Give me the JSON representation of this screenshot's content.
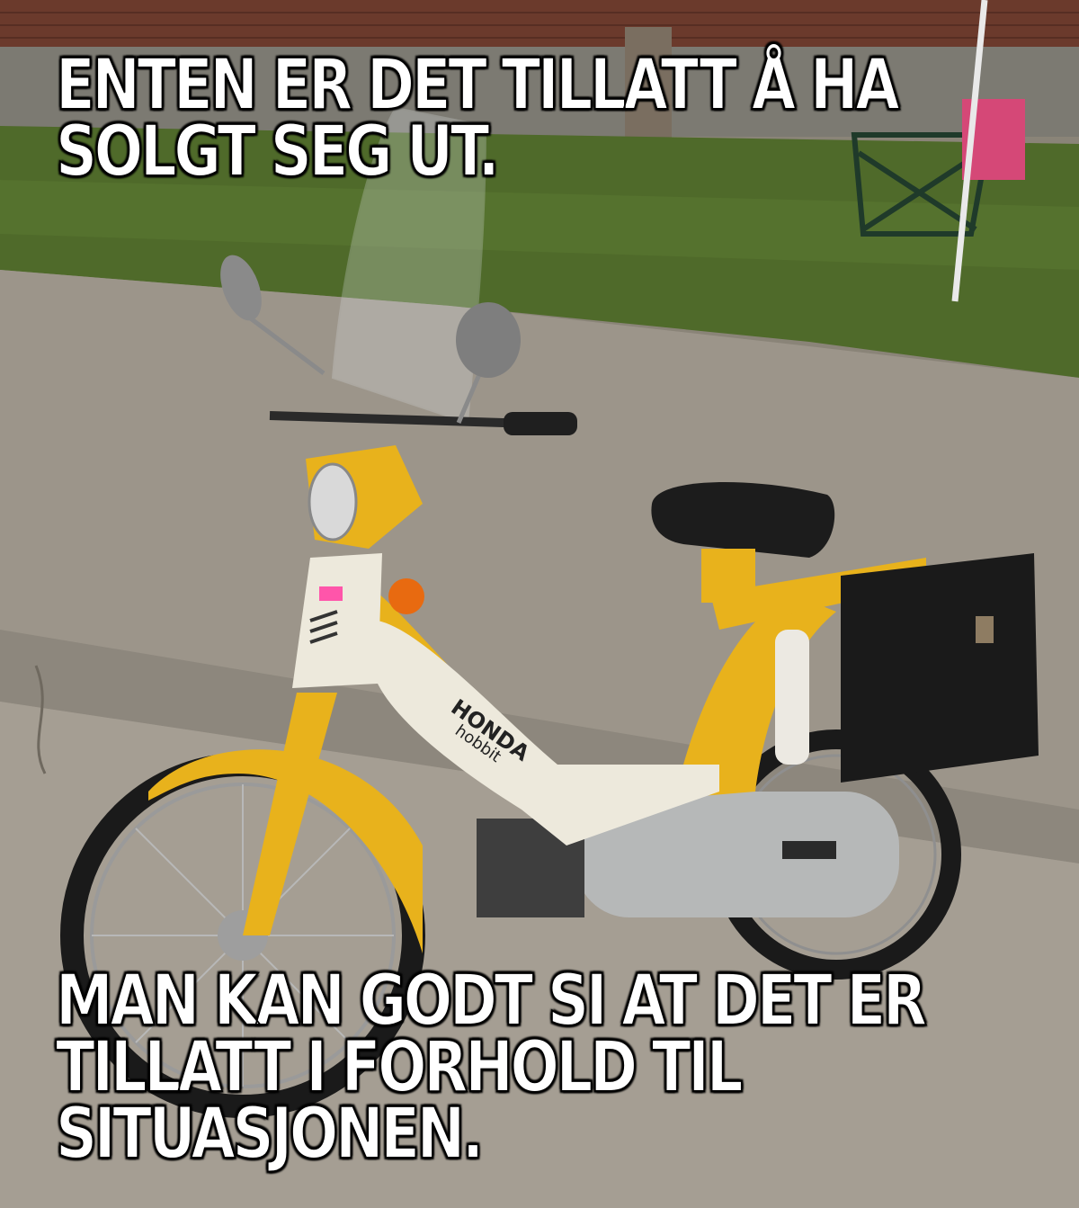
{
  "meme": {
    "top_text_lines": [
      "ENTEN ER DET TILLATT Å HA",
      "SOLGT SEG UT."
    ],
    "bottom_text_lines": [
      "MAN KAN GODT SI AT DET ER",
      "TILLATT I FORHOLD TIL",
      "SITUASJONEN."
    ]
  },
  "photo": {
    "subject": "yellow moped",
    "brand_badge": "HONDA",
    "model_badge": "hobbit",
    "colors": {
      "body": "#e8b21c",
      "panel": "#ede9dc",
      "seat": "#1c1c1c",
      "pavement": "#9c958a",
      "grass": "#4f6a2a",
      "wall": "#6b3a2c"
    }
  }
}
